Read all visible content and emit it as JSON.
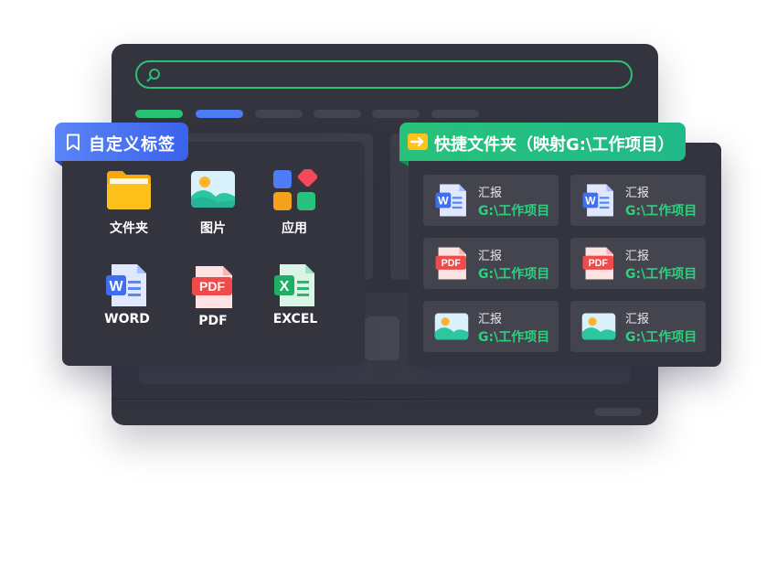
{
  "window": {
    "search": {
      "icon": "search-icon"
    }
  },
  "tags_panel": {
    "title": "自定义标签",
    "title_icon": "bookmark-icon",
    "categories": [
      {
        "label": "文件夹",
        "icon": "folder-icon"
      },
      {
        "label": "图片",
        "icon": "image-icon"
      },
      {
        "label": "应用",
        "icon": "apps-icon"
      },
      {
        "label": "WORD",
        "icon": "word-icon"
      },
      {
        "label": "PDF",
        "icon": "pdf-icon"
      },
      {
        "label": "EXCEL",
        "icon": "excel-icon"
      }
    ]
  },
  "quick_panel": {
    "title": "快捷文件夹（映射G:\\工作项目）",
    "title_icon": "arrow-folder-icon",
    "files": [
      {
        "name": "汇报",
        "path": "G:\\工作项目",
        "icon": "word-icon"
      },
      {
        "name": "汇报",
        "path": "G:\\工作项目",
        "icon": "word-icon"
      },
      {
        "name": "汇报",
        "path": "G:\\工作项目",
        "icon": "pdf-icon"
      },
      {
        "name": "汇报",
        "path": "G:\\工作项目",
        "icon": "pdf-icon"
      },
      {
        "name": "汇报",
        "path": "G:\\工作项目",
        "icon": "image-icon"
      },
      {
        "name": "汇报",
        "path": "G:\\工作项目",
        "icon": "image-icon"
      }
    ]
  },
  "icon_text": {
    "word": "W",
    "pdf": "PDF",
    "excel": "X"
  },
  "colors": {
    "accent_green": "#27c273",
    "accent_blue": "#4d7cf4",
    "panel_bg": "#34343f",
    "card_bg": "#44444f",
    "path_text": "#2bd17f"
  }
}
